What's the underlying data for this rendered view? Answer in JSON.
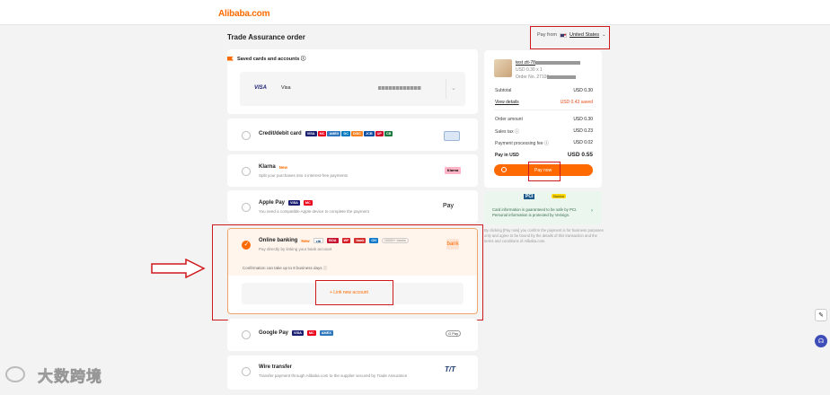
{
  "header": {
    "logo": "Alibaba.com"
  },
  "page": {
    "title": "Trade Assurance order",
    "pay_from_label": "Pay from",
    "pay_from_country": "United States",
    "pay_from_chevron": "⌄"
  },
  "saved_cards": {
    "heading": "Saved cards and accounts ⓘ",
    "visa_logo": "VISA",
    "visa_name": "Visa",
    "chevron": "⌄"
  },
  "methods": [
    {
      "title": "Credit/debit card",
      "subtitle": "",
      "new": "",
      "brands": [
        "VISA",
        "MC",
        "AMEX",
        "DC",
        "DISC",
        "JCB",
        "UP",
        "CB"
      ],
      "right_logo": "card"
    },
    {
      "title": "Klarna",
      "subtitle": "Split your purchases into 4 interest-free payments",
      "new": "New",
      "brands": [],
      "right_logo": "Klarna"
    },
    {
      "title": "Apple Pay",
      "subtitle": "You need a compatible Apple device to complete the payment",
      "new": "",
      "brands": [
        "VISA",
        "MC"
      ],
      "right_logo": " Pay"
    },
    {
      "title": "Online banking",
      "subtitle": "Pay directly by linking your bank account",
      "new": "New",
      "brands": [
        "citi",
        "BOA",
        "WF",
        "bank",
        "CH"
      ],
      "extra": "10000+ banks",
      "right_logo": "bank"
    },
    {
      "title": "Google Pay",
      "subtitle": "",
      "new": "",
      "brands": [
        "VISA",
        "MC",
        "AMEX"
      ],
      "right_logo": "G Pay"
    },
    {
      "title": "Wire transfer",
      "subtitle": "Transfer payment through Alibaba.com to the supplier secured by Trade Assurance",
      "new": "",
      "brands": [],
      "right_logo": "T/T"
    }
  ],
  "online_banking": {
    "confirmation": "Confirmation can take up to 8 business days ⓘ",
    "link_label": "+ Link new account"
  },
  "summary": {
    "product_name": "test ztt-78",
    "product_qty": "USD 0.30 x 1",
    "order_no": "Order No. 27106",
    "subtotal_label": "Subtotal",
    "subtotal_value": "USD 0.30",
    "view_details": "View details",
    "saved": "USD 0.43 saved",
    "order_amount_label": "Order amount",
    "order_amount_value": "USD 0.30",
    "sales_tax_label": "Sales tax ⓘ",
    "sales_tax_value": "USD 0.23",
    "processing_fee_label": "Payment processing fee ⓘ",
    "processing_fee_value": "USD 0.02",
    "pay_in_label": "Pay in  USD",
    "pay_in_value": "USD 0.55",
    "pay_now": "Pay now"
  },
  "secure": {
    "pci": "PCI",
    "norton": "Norton",
    "text": "Card information is guaranteed to be safe by PCI. Personal information is protected by Verisign.",
    "arrow": "›"
  },
  "disclaimer": "By clicking [Pay now] you confirm the payment is for business purposes only and agree to be bound by the details of this transaction and the terms and conditions of Alibaba.com.",
  "watermark": "大数跨境",
  "colors": {
    "accent": "#ff6a00",
    "annotation": "#d0191e"
  }
}
